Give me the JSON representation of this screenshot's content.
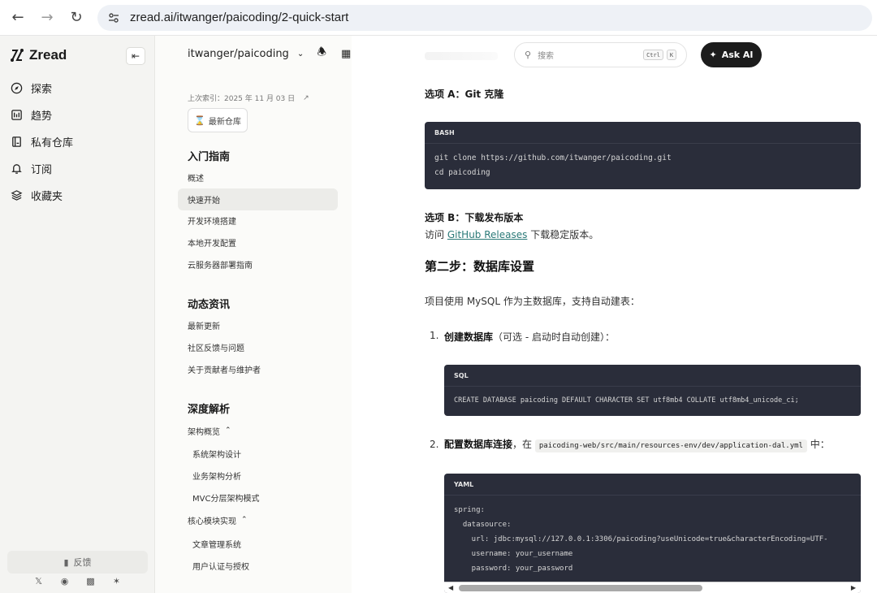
{
  "browser": {
    "url": "zread.ai/itwanger/paicoding/2-quick-start"
  },
  "app": {
    "brand": "Zread",
    "nav": [
      {
        "label": "探索",
        "icon": "compass-icon"
      },
      {
        "label": "趋势",
        "icon": "trending-icon"
      },
      {
        "label": "私有仓库",
        "icon": "private-repo-icon"
      },
      {
        "label": "订阅",
        "icon": "bell-icon"
      },
      {
        "label": "收藏夹",
        "icon": "bookmark-stack-icon"
      }
    ],
    "feedback_label": "反馈"
  },
  "doc_sidebar": {
    "repo": "itwanger/paicoding",
    "last_indexed": "上次索引：2025 年 11 月 03 日",
    "latest_button": "最新仓库",
    "sections": {
      "getting_started": {
        "title": "入门指南",
        "items": [
          "概述",
          "快速开始",
          "开发环境搭建",
          "本地开发配置",
          "云服务器部署指南"
        ]
      },
      "news": {
        "title": "动态资讯",
        "items": [
          "最新更新",
          "社区反馈与问题",
          "关于贡献者与维护者"
        ]
      },
      "deep_dive": {
        "title": "深度解析",
        "group1": "架构概览",
        "group1_items": [
          "系统架构设计",
          "业务架构分析",
          "MVC分层架构模式"
        ],
        "group2": "核心模块实现",
        "group2_items": [
          "文章管理系统",
          "用户认证与授权"
        ]
      }
    }
  },
  "toolbar": {
    "search_placeholder": "搜索",
    "kbd_ctrl": "Ctrl",
    "kbd_k": "K",
    "ask_label": "Ask AI"
  },
  "content": {
    "option_a": "选项 A：Git 克隆",
    "bash_label": "BASH",
    "bash_lines": [
      "git clone https://github.com/itwanger/paicoding.git",
      "cd paicoding"
    ],
    "option_b": "选项 B：下载发布版本",
    "visit_prefix": "访问",
    "releases_link": "GitHub Releases",
    "visit_suffix": "下载稳定版本。",
    "step2": "第二步：数据库设置",
    "step2_desc": "项目使用 MySQL 作为主数据库，支持自动建表：",
    "item1_num": "1.",
    "item1_bold": "创建数据库",
    "item1_rest": "（可选 - 启动时自动创建）：",
    "sql_label": "SQL",
    "sql_line": "CREATE DATABASE paicoding DEFAULT CHARACTER SET utf8mb4 COLLATE utf8mb4_unicode_ci;",
    "item2_num": "2.",
    "item2_bold": "配置数据库连接",
    "item2_mid": "，在",
    "item2_code": "paicoding-web/src/main/resources-env/dev/application-dal.yml",
    "item2_suffix": "中：",
    "yaml_label": "YAML",
    "yaml_lines": [
      "spring:",
      "  datasource:",
      "    url: jdbc:mysql://127.0.0.1:3306/paicoding?useUnicode=true&characterEncoding=UTF-",
      "    username: your_username",
      "    password: your_password"
    ]
  }
}
